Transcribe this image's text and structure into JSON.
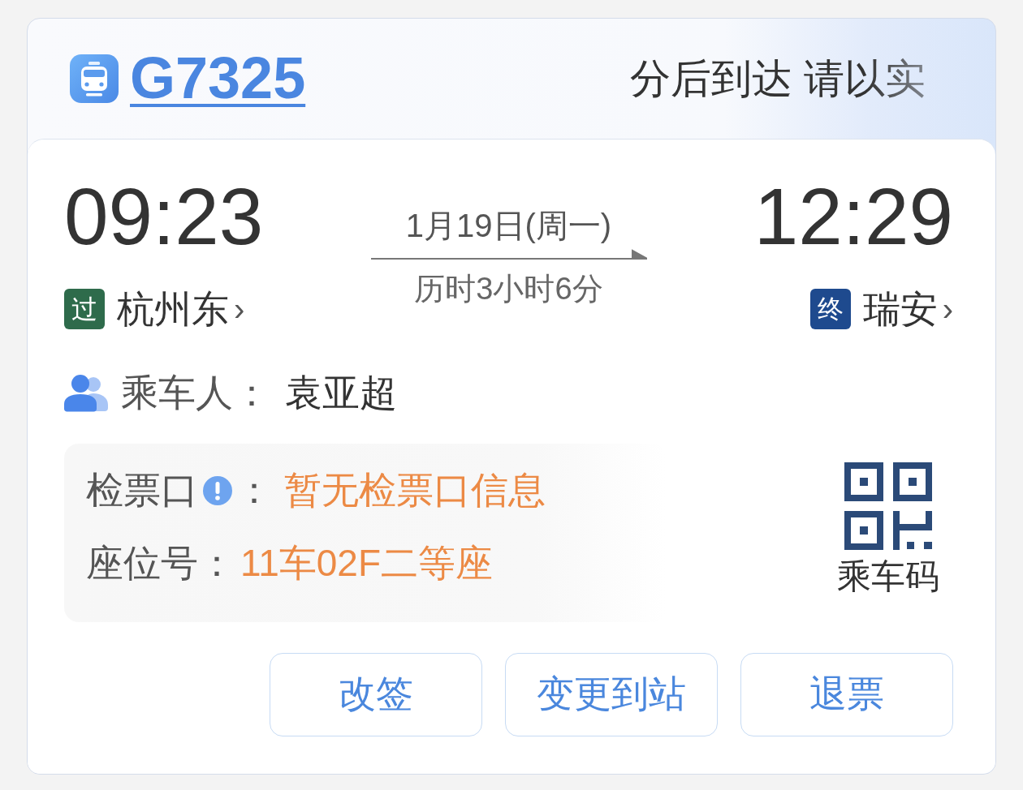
{
  "header": {
    "train_number": "G7325",
    "notice": "分后到达 请以实"
  },
  "stations": [
    {
      "time": "09:23",
      "tag": "过",
      "color": "#2e6b4b",
      "name": "杭州东",
      "chevron": "›"
    },
    {
      "time": "12:29",
      "tag": "终",
      "color": "#1e4a8e",
      "name": "瑞安",
      "chevron": "›"
    }
  ],
  "journey": {
    "date": "1月19日(周一)",
    "duration": "历时3小时6分"
  },
  "passenger": {
    "label": "乘车人：",
    "name": "袁亚超"
  },
  "ticket_info": [
    {
      "kind": "info",
      "label": "检票口",
      "separator": "：",
      "value": "暂无检票口信息"
    },
    {
      "kind": "plain",
      "label": "座位号",
      "separator": "：",
      "value": "11车02F二等座"
    }
  ],
  "ride_code": {
    "label": "乘车码"
  },
  "actions": [
    "改签",
    "变更到站",
    "退票"
  ]
}
